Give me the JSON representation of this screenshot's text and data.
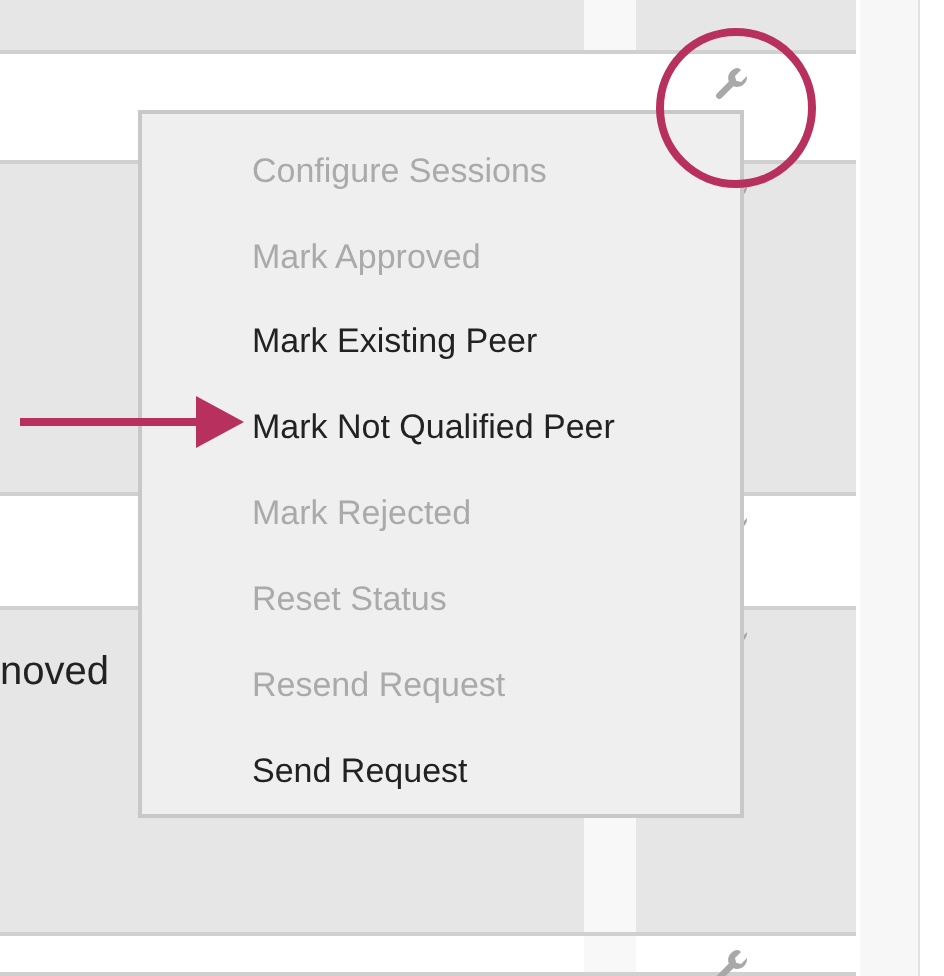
{
  "table": {
    "row_text": "noved"
  },
  "menu": {
    "items": [
      {
        "label": "Configure Sessions",
        "disabled": true
      },
      {
        "label": "Mark Approved",
        "disabled": true
      },
      {
        "label": "Mark Existing Peer",
        "disabled": false
      },
      {
        "label": "Mark Not Qualified Peer",
        "disabled": false
      },
      {
        "label": "Mark Rejected",
        "disabled": true
      },
      {
        "label": "Reset Status",
        "disabled": true
      },
      {
        "label": "Resend Request",
        "disabled": true
      },
      {
        "label": "Send Request",
        "disabled": false
      }
    ]
  }
}
